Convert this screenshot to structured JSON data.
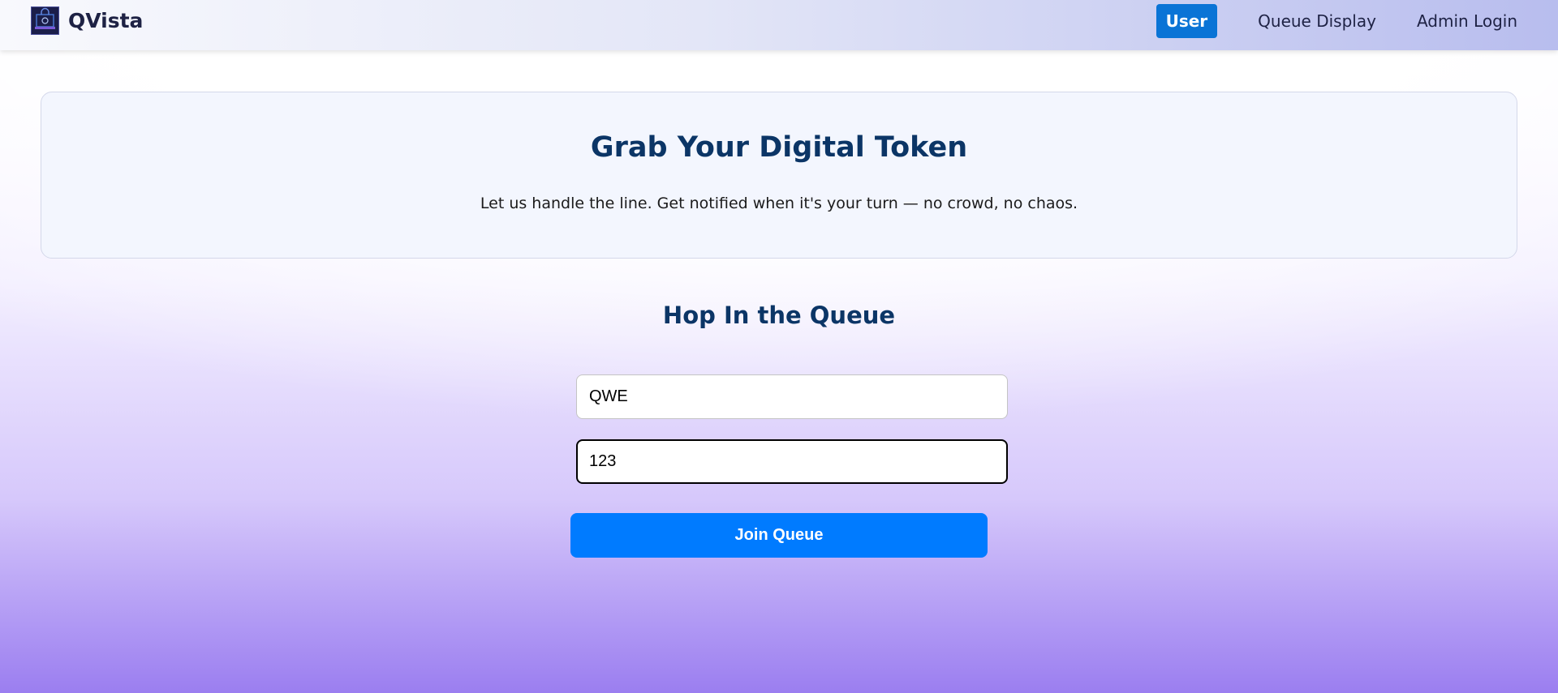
{
  "nav": {
    "brand": "QVista",
    "links": [
      {
        "label": "User",
        "active": true
      },
      {
        "label": "Queue Display",
        "active": false
      },
      {
        "label": "Admin Login",
        "active": false
      }
    ]
  },
  "hero": {
    "title": "Grab Your Digital Token",
    "subtitle": "Let us handle the line. Get notified when it's your turn — no crowd, no chaos."
  },
  "form": {
    "title": "Hop In the Queue",
    "name_value": "QWE",
    "phone_value": "123",
    "submit_label": "Join Queue"
  },
  "colors": {
    "primary": "#007bff",
    "nav_active": "#0a74d6",
    "heading": "#0b3566"
  }
}
